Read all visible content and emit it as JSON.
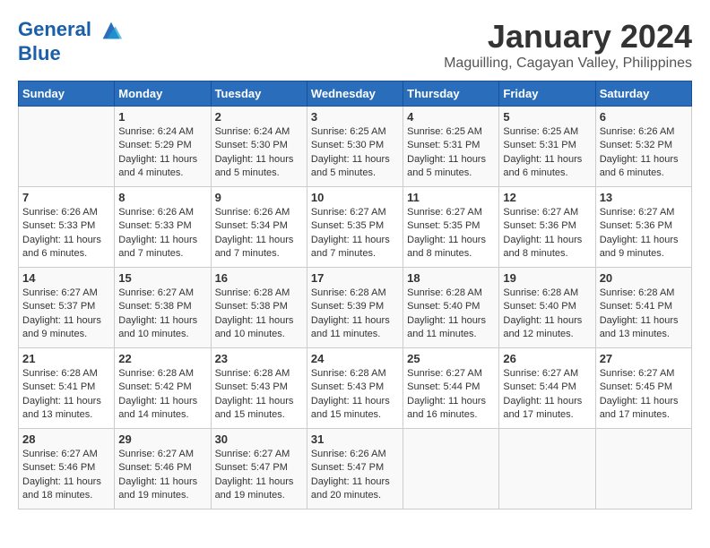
{
  "header": {
    "logo_line1": "General",
    "logo_line2": "Blue",
    "month": "January 2024",
    "location": "Maguilling, Cagayan Valley, Philippines"
  },
  "weekdays": [
    "Sunday",
    "Monday",
    "Tuesday",
    "Wednesday",
    "Thursday",
    "Friday",
    "Saturday"
  ],
  "weeks": [
    [
      {
        "day": "",
        "content": ""
      },
      {
        "day": "1",
        "content": "Sunrise: 6:24 AM\nSunset: 5:29 PM\nDaylight: 11 hours\nand 4 minutes."
      },
      {
        "day": "2",
        "content": "Sunrise: 6:24 AM\nSunset: 5:30 PM\nDaylight: 11 hours\nand 5 minutes."
      },
      {
        "day": "3",
        "content": "Sunrise: 6:25 AM\nSunset: 5:30 PM\nDaylight: 11 hours\nand 5 minutes."
      },
      {
        "day": "4",
        "content": "Sunrise: 6:25 AM\nSunset: 5:31 PM\nDaylight: 11 hours\nand 5 minutes."
      },
      {
        "day": "5",
        "content": "Sunrise: 6:25 AM\nSunset: 5:31 PM\nDaylight: 11 hours\nand 6 minutes."
      },
      {
        "day": "6",
        "content": "Sunrise: 6:26 AM\nSunset: 5:32 PM\nDaylight: 11 hours\nand 6 minutes."
      }
    ],
    [
      {
        "day": "7",
        "content": "Sunrise: 6:26 AM\nSunset: 5:33 PM\nDaylight: 11 hours\nand 6 minutes."
      },
      {
        "day": "8",
        "content": "Sunrise: 6:26 AM\nSunset: 5:33 PM\nDaylight: 11 hours\nand 7 minutes."
      },
      {
        "day": "9",
        "content": "Sunrise: 6:26 AM\nSunset: 5:34 PM\nDaylight: 11 hours\nand 7 minutes."
      },
      {
        "day": "10",
        "content": "Sunrise: 6:27 AM\nSunset: 5:35 PM\nDaylight: 11 hours\nand 7 minutes."
      },
      {
        "day": "11",
        "content": "Sunrise: 6:27 AM\nSunset: 5:35 PM\nDaylight: 11 hours\nand 8 minutes."
      },
      {
        "day": "12",
        "content": "Sunrise: 6:27 AM\nSunset: 5:36 PM\nDaylight: 11 hours\nand 8 minutes."
      },
      {
        "day": "13",
        "content": "Sunrise: 6:27 AM\nSunset: 5:36 PM\nDaylight: 11 hours\nand 9 minutes."
      }
    ],
    [
      {
        "day": "14",
        "content": "Sunrise: 6:27 AM\nSunset: 5:37 PM\nDaylight: 11 hours\nand 9 minutes."
      },
      {
        "day": "15",
        "content": "Sunrise: 6:27 AM\nSunset: 5:38 PM\nDaylight: 11 hours\nand 10 minutes."
      },
      {
        "day": "16",
        "content": "Sunrise: 6:28 AM\nSunset: 5:38 PM\nDaylight: 11 hours\nand 10 minutes."
      },
      {
        "day": "17",
        "content": "Sunrise: 6:28 AM\nSunset: 5:39 PM\nDaylight: 11 hours\nand 11 minutes."
      },
      {
        "day": "18",
        "content": "Sunrise: 6:28 AM\nSunset: 5:40 PM\nDaylight: 11 hours\nand 11 minutes."
      },
      {
        "day": "19",
        "content": "Sunrise: 6:28 AM\nSunset: 5:40 PM\nDaylight: 11 hours\nand 12 minutes."
      },
      {
        "day": "20",
        "content": "Sunrise: 6:28 AM\nSunset: 5:41 PM\nDaylight: 11 hours\nand 13 minutes."
      }
    ],
    [
      {
        "day": "21",
        "content": "Sunrise: 6:28 AM\nSunset: 5:41 PM\nDaylight: 11 hours\nand 13 minutes."
      },
      {
        "day": "22",
        "content": "Sunrise: 6:28 AM\nSunset: 5:42 PM\nDaylight: 11 hours\nand 14 minutes."
      },
      {
        "day": "23",
        "content": "Sunrise: 6:28 AM\nSunset: 5:43 PM\nDaylight: 11 hours\nand 15 minutes."
      },
      {
        "day": "24",
        "content": "Sunrise: 6:28 AM\nSunset: 5:43 PM\nDaylight: 11 hours\nand 15 minutes."
      },
      {
        "day": "25",
        "content": "Sunrise: 6:27 AM\nSunset: 5:44 PM\nDaylight: 11 hours\nand 16 minutes."
      },
      {
        "day": "26",
        "content": "Sunrise: 6:27 AM\nSunset: 5:44 PM\nDaylight: 11 hours\nand 17 minutes."
      },
      {
        "day": "27",
        "content": "Sunrise: 6:27 AM\nSunset: 5:45 PM\nDaylight: 11 hours\nand 17 minutes."
      }
    ],
    [
      {
        "day": "28",
        "content": "Sunrise: 6:27 AM\nSunset: 5:46 PM\nDaylight: 11 hours\nand 18 minutes."
      },
      {
        "day": "29",
        "content": "Sunrise: 6:27 AM\nSunset: 5:46 PM\nDaylight: 11 hours\nand 19 minutes."
      },
      {
        "day": "30",
        "content": "Sunrise: 6:27 AM\nSunset: 5:47 PM\nDaylight: 11 hours\nand 19 minutes."
      },
      {
        "day": "31",
        "content": "Sunrise: 6:26 AM\nSunset: 5:47 PM\nDaylight: 11 hours\nand 20 minutes."
      },
      {
        "day": "",
        "content": ""
      },
      {
        "day": "",
        "content": ""
      },
      {
        "day": "",
        "content": ""
      }
    ]
  ]
}
